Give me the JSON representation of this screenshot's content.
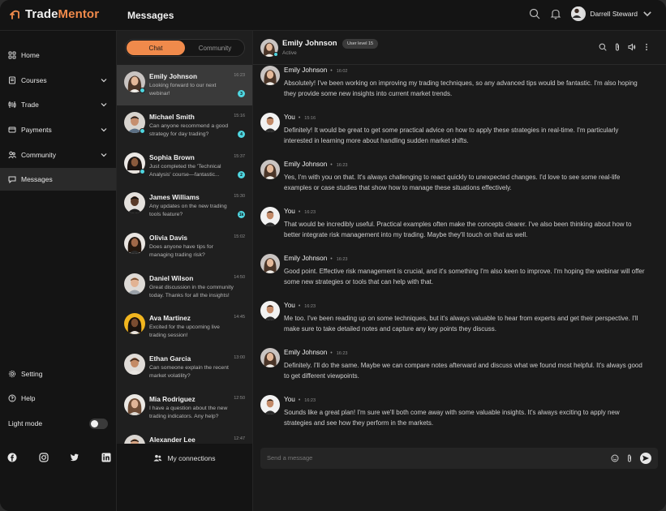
{
  "app": {
    "brand_prefix": "Trade",
    "brand_suffix": "Mentor",
    "page_title": "Messages",
    "user_name": "Darrell Steward"
  },
  "sidebar": {
    "items": [
      {
        "label": "Home",
        "icon": "home-icon"
      },
      {
        "label": "Courses",
        "icon": "courses-icon",
        "expandable": true
      },
      {
        "label": "Trade",
        "icon": "trade-icon",
        "expandable": true
      },
      {
        "label": "Payments",
        "icon": "payments-icon",
        "expandable": true
      },
      {
        "label": "Community",
        "icon": "community-icon",
        "expandable": true
      },
      {
        "label": "Messages",
        "icon": "messages-icon",
        "active": true
      }
    ],
    "setting_label": "Setting",
    "help_label": "Help",
    "light_mode_label": "Light mode",
    "light_mode_on": false,
    "socials": [
      "facebook-icon",
      "instagram-icon",
      "twitter-icon",
      "linkedin-icon"
    ]
  },
  "conversations": {
    "tabs": {
      "chat": "Chat",
      "community": "Community"
    },
    "active_tab": "Chat",
    "my_connections_label": "My connections",
    "items": [
      {
        "name": "Emily Johnson",
        "time": "16:23",
        "preview": "Looking forward to our next webinar!",
        "unread": "3",
        "online": true,
        "active": true
      },
      {
        "name": "Michael Smith",
        "time": "15:16",
        "preview": "Can anyone recommend a good strategy for day trading?",
        "unread": "4",
        "online": true
      },
      {
        "name": "Sophia Brown",
        "time": "15:37",
        "preview": "Just completed the 'Technical Analysis' course—fantastic...",
        "unread": "2",
        "online": true
      },
      {
        "name": "James Williams",
        "time": "15:30",
        "preview": "Any updates on the new trading tools feature?",
        "unread": "1k",
        "online": false
      },
      {
        "name": "Olivia Davis",
        "time": "15:02",
        "preview": "Does anyone have tips for managing trading risk?",
        "unread": "",
        "online": false
      },
      {
        "name": "Daniel Wilson",
        "time": "14:50",
        "preview": "Great discussion in the community today. Thanks for all the insights!",
        "unread": "",
        "online": false
      },
      {
        "name": "Ava Martinez",
        "time": "14:45",
        "preview": "Excited for the upcoming live trading session!",
        "unread": "",
        "online": false
      },
      {
        "name": "Ethan Garcia",
        "time": "13:00",
        "preview": "Can someone explain the recent market volatility?",
        "unread": "",
        "online": false
      },
      {
        "name": "Mia Rodriguez",
        "time": "12:50",
        "preview": "I have a question about the new trading indicators. Any help?",
        "unread": "",
        "online": false
      },
      {
        "name": "Alexander Lee",
        "time": "12:47",
        "preview": "",
        "unread": "",
        "online": false
      }
    ]
  },
  "chat": {
    "contact_name": "Emily Johnson",
    "contact_status": "Active",
    "user_level": "User level 15",
    "composer_placeholder": "Send a message",
    "messages": [
      {
        "sender": "Emily Johnson",
        "time": "16:02",
        "text": "Absolutely! I've been working on improving my trading techniques, so any advanced tips would be fantastic. I'm also hoping they provide some new insights into current market trends.",
        "self": false
      },
      {
        "sender": "You",
        "time": "15:16",
        "text": "Definitely! It would be great to get some practical advice on how to apply these strategies in real-time. I'm particularly interested in learning more about handling sudden market shifts.",
        "self": true
      },
      {
        "sender": "Emily Johnson",
        "time": "16:23",
        "text": "Yes, I'm with you on that. It's always challenging to react quickly to unexpected changes. I'd love to see some real-life examples or case studies that show how to manage these situations effectively.",
        "self": false
      },
      {
        "sender": "You",
        "time": "16:23",
        "text": "That would be incredibly useful. Practical examples often make the concepts clearer. I've also been thinking about how to better integrate risk management into my trading. Maybe they'll touch on that as well.",
        "self": true
      },
      {
        "sender": "Emily Johnson",
        "time": "16:23",
        "text": "Good point. Effective risk management is crucial, and it's something I'm also keen to improve. I'm hoping the webinar will offer some new strategies or tools that can help with that.",
        "self": false
      },
      {
        "sender": "You",
        "time": "16:23",
        "text": "Me too. I've been reading up on some techniques, but it's always valuable to hear from experts and get their perspective. I'll make sure to take detailed notes and capture any key points they discuss.",
        "self": true
      },
      {
        "sender": "Emily Johnson",
        "time": "16:23",
        "text": "Definitely. I'll do the same. Maybe we can compare notes afterward and discuss what we found most helpful. It's always good to get different viewpoints.",
        "self": false
      },
      {
        "sender": "You",
        "time": "16:23",
        "text": "Sounds like a great plan! I'm sure we'll both come away with some valuable insights. It's always exciting to apply new strategies and see how they perform in the markets.",
        "self": true
      }
    ]
  },
  "colors": {
    "accent": "#f08a4b",
    "online": "#4fd6e0",
    "background": "#141414"
  }
}
